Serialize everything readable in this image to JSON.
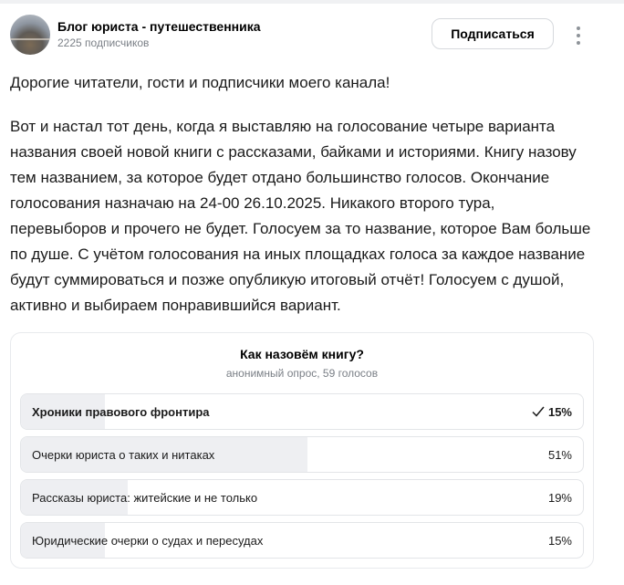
{
  "channel": {
    "name": "Блог юриста - путешественника",
    "subscribers": "2225 подписчиков",
    "subscribe_label": "Подписаться",
    "avatar_icon": "landscape-avatar",
    "more_icon": "kebab-menu-icon"
  },
  "post": {
    "greeting": "Дорогие читатели, гости и подписчики моего канала!",
    "lines": [
      "Вот и настал тот день, когда я выставляю на голосование четыре варианта",
      "названия своей новой книги с рассказами, байками и историями. Книгу назову",
      "тем названием, за которое будет отдано большинство голосов. Окончание",
      "голосования назначаю на 24-00 26.10.2025. Никакого второго тура,",
      "перевыборов и прочего не будет. Голосуем за то название, которое Вам больше",
      "по душе. С учётом голосования на иных площадках голоса за каждое название",
      "будут суммироваться и позже опубликую итоговый отчёт! Голосуем с душой,",
      "активно и выбираем понравившийся вариант."
    ]
  },
  "poll": {
    "title": "Как назовём книгу?",
    "meta": "анонимный опрос, 59 голосов",
    "options": [
      {
        "label": "Хроники правового фронтира",
        "percent_text": "15%",
        "percent": 15,
        "chosen": true
      },
      {
        "label": "Очерки юриста о таких и нитаках",
        "percent_text": "51%",
        "percent": 51,
        "chosen": false
      },
      {
        "label": "Рассказы юриста: житейские и не только",
        "percent_text": "19%",
        "percent": 19,
        "chosen": false
      },
      {
        "label": "Юридические очерки о судах и пересудах",
        "percent_text": "15%",
        "percent": 15,
        "chosen": false
      }
    ],
    "check_icon": "checkmark-icon",
    "colors": {
      "fill": "#eeeff2",
      "border": "#e3e5e8"
    }
  }
}
